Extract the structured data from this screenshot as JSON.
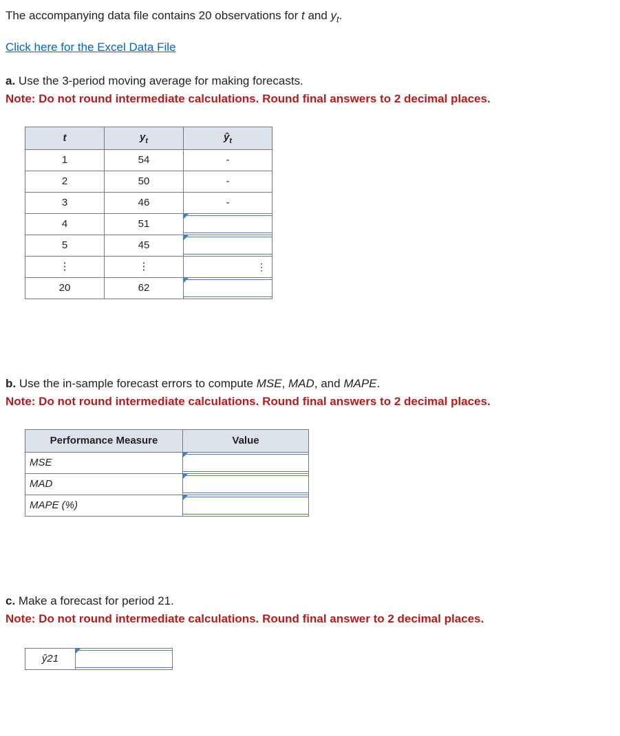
{
  "intro": {
    "prefix": "The accompanying data file contains 20 observations for ",
    "var_t": "t",
    "and": " and ",
    "var_y": "y",
    "var_y_sub": "t",
    "suffix": "."
  },
  "link_text": "Click here for the Excel Data File",
  "part_a": {
    "label": "a.",
    "text": " Use the 3-period moving average for making forecasts.",
    "note": "Note: Do not round intermediate calculations. Round final answers to 2 decimal places."
  },
  "table_a": {
    "headers": {
      "t": "t",
      "yt": "y",
      "yt_sub": "t",
      "yhat": "ŷ",
      "yhat_sub": "t"
    },
    "rows": [
      {
        "t": "1",
        "yt": "54",
        "yhat_static": "-"
      },
      {
        "t": "2",
        "yt": "50",
        "yhat_static": "-"
      },
      {
        "t": "3",
        "yt": "46",
        "yhat_static": "-"
      },
      {
        "t": "4",
        "yt": "51",
        "yhat_input": ""
      },
      {
        "t": "5",
        "yt": "45",
        "yhat_input": ""
      },
      {
        "t": "⋮",
        "yt": "⋮",
        "yhat_vdots": "⋮"
      },
      {
        "t": "20",
        "yt": "62",
        "yhat_input": ""
      }
    ]
  },
  "part_b": {
    "label": "b.",
    "text_pre": " Use the in-sample forecast errors to compute ",
    "m1": "MSE",
    "c1": ", ",
    "m2": "MAD",
    "c2": ", and ",
    "m3": "MAPE",
    "c3": ".",
    "note": "Note: Do not round intermediate calculations. Round final answers to 2 decimal places."
  },
  "table_b": {
    "headers": {
      "pm": "Performance Measure",
      "val": "Value"
    },
    "rows": [
      {
        "label": "MSE",
        "value": ""
      },
      {
        "label": "MAD",
        "value": ""
      },
      {
        "label": "MAPE (%)",
        "value": ""
      }
    ]
  },
  "part_c": {
    "label": "c.",
    "text": " Make a forecast for period 21.",
    "note": "Note: Do not round intermediate calculations. Round final answer to 2 decimal places."
  },
  "table_c": {
    "label": "ŷ21",
    "value": ""
  }
}
